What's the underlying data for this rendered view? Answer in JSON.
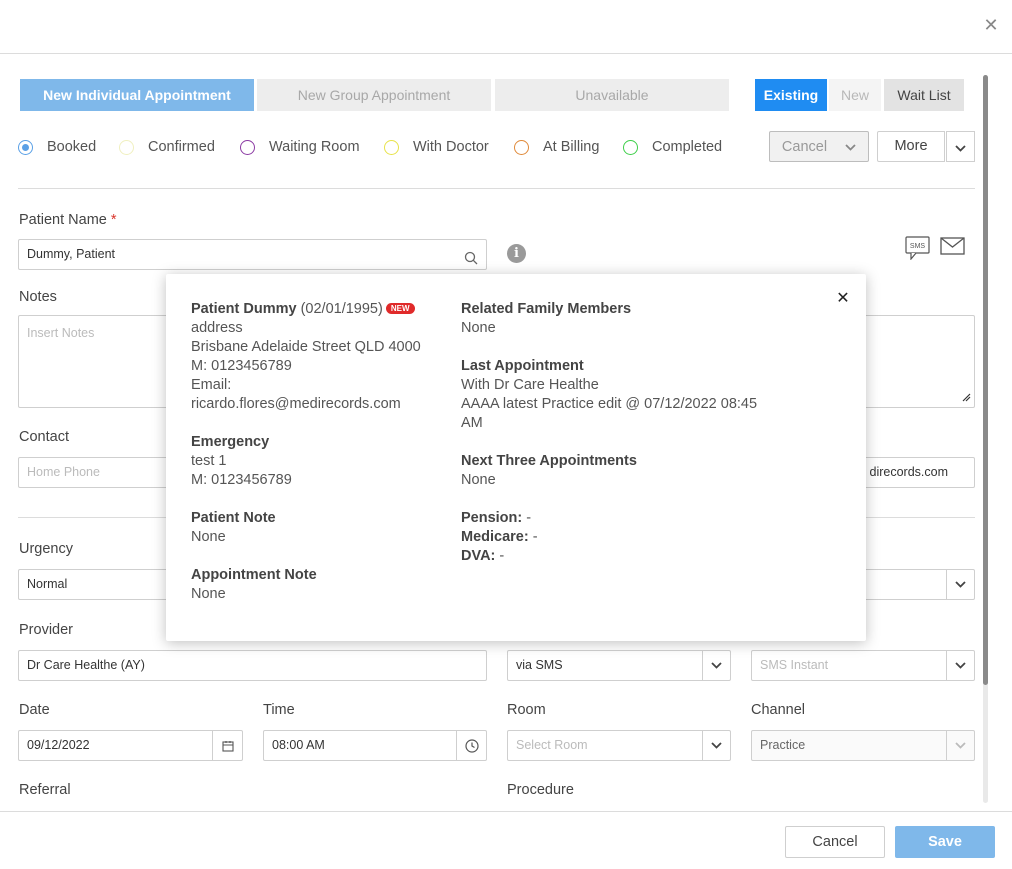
{
  "tabs": [
    "New Individual Appointment",
    "New Group Appointment",
    "Unavailable"
  ],
  "patient_type": [
    "Existing",
    "New",
    "Wait List"
  ],
  "statuses": [
    {
      "label": "Booked",
      "color": "#5aa0e6",
      "selected": true
    },
    {
      "label": "Confirmed",
      "color": "#f2f2c8"
    },
    {
      "label": "Waiting Room",
      "color": "#8b3aa3"
    },
    {
      "label": "With Doctor",
      "color": "#e8e34a"
    },
    {
      "label": "At Billing",
      "color": "#e08a3a"
    },
    {
      "label": "Completed",
      "color": "#3ecf4a"
    }
  ],
  "actions": {
    "cancel": "Cancel",
    "more": "More"
  },
  "form": {
    "patient_name_label": "Patient Name",
    "required_mark": "*",
    "patient_name_value": "Dummy, Patient",
    "notes_label": "Notes",
    "notes_placeholder": "Insert Notes",
    "contact_label": "Contact",
    "home_phone_placeholder": "Home Phone",
    "email_partial": "direcords.com",
    "urgency_label": "Urgency",
    "urgency_value": "Normal",
    "provider_label": "Provider",
    "provider_value": "Dr Care Healthe (AY)",
    "reminder_value": "via SMS",
    "sms_placeholder": "SMS Instant",
    "date_label": "Date",
    "date_value": "09/12/2022",
    "time_label": "Time",
    "time_value": "08:00 AM",
    "room_label": "Room",
    "room_placeholder": "Select Room",
    "channel_label": "Channel",
    "channel_value": "Practice",
    "referral_label": "Referral",
    "procedure_label": "Procedure",
    "sms_icon_text": "SMS"
  },
  "popover": {
    "name": "Patient Dummy",
    "dob": "(02/01/1995)",
    "badge": "NEW",
    "address_label": "address",
    "address": "Brisbane Adelaide Street QLD 4000",
    "mobile": "M: 0123456789",
    "email_label": "Email:",
    "email": "ricardo.flores@medirecords.com",
    "emergency_h": "Emergency",
    "emergency_name": "test 1",
    "emergency_mobile": "M: 0123456789",
    "patient_note_h": "Patient Note",
    "patient_note": "None",
    "appt_note_h": "Appointment Note",
    "appt_note": "None",
    "family_h": "Related Family Members",
    "family": "None",
    "last_appt_h": "Last Appointment",
    "last_appt_line1": "With Dr Care Healthe",
    "last_appt_line2": "AAAA latest Practice edit @ 07/12/2022 08:45",
    "last_appt_line3": "AM",
    "next_h": "Next Three Appointments",
    "next": "None",
    "pension_h": "Pension:",
    "pension": " -",
    "medicare_h": "Medicare:",
    "medicare": " -",
    "dva_h": "DVA:",
    "dva": " -"
  },
  "footer": {
    "cancel": "Cancel",
    "save": "Save"
  }
}
